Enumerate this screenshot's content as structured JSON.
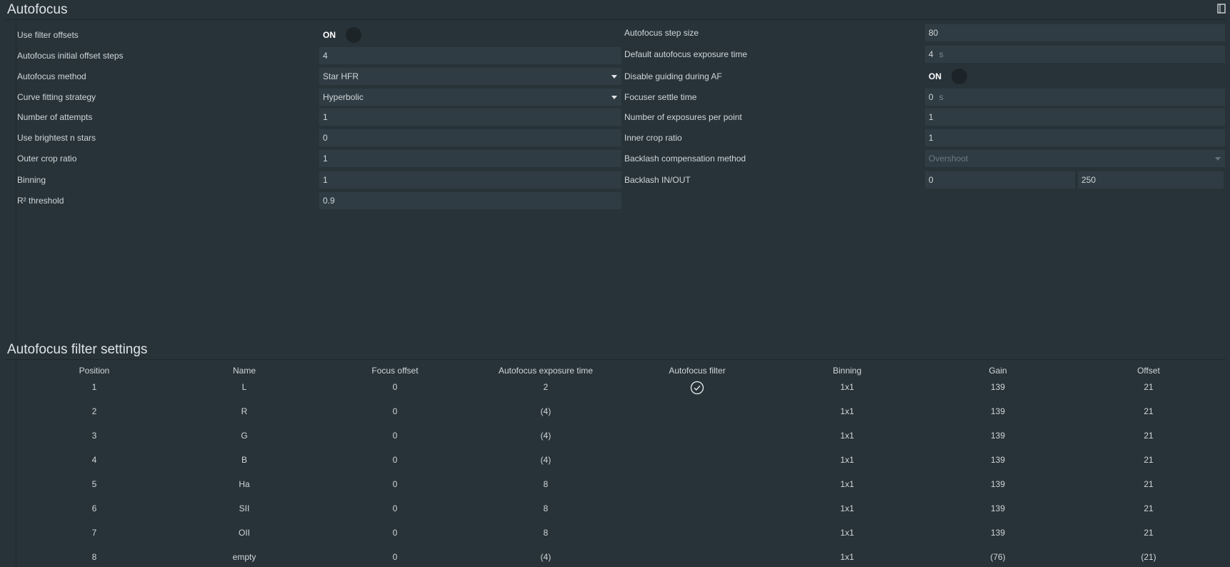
{
  "autofocus": {
    "title": "Autofocus",
    "left": [
      {
        "label": "Use filter offsets",
        "type": "toggle",
        "value": "ON"
      },
      {
        "label": "Autofocus initial offset steps",
        "type": "input",
        "value": "4"
      },
      {
        "label": "Autofocus method",
        "type": "select",
        "value": "Star HFR"
      },
      {
        "label": "Curve fitting strategy",
        "type": "select",
        "value": "Hyperbolic"
      },
      {
        "label": "Number of attempts",
        "type": "input",
        "value": "1"
      },
      {
        "label": "Use brightest n stars",
        "type": "input",
        "value": "0"
      },
      {
        "label": "Outer crop ratio",
        "type": "input",
        "value": "1"
      },
      {
        "label": "Binning",
        "type": "input",
        "value": "1"
      },
      {
        "label": "R² threshold",
        "type": "input",
        "value": "0.9"
      }
    ],
    "right": [
      {
        "label": "Autofocus step size",
        "type": "input",
        "value": "80"
      },
      {
        "label": "Default autofocus exposure time",
        "type": "input",
        "value": "4",
        "unit": "s"
      },
      {
        "label": "Disable guiding during AF",
        "type": "toggle",
        "value": "ON"
      },
      {
        "label": "Focuser settle time",
        "type": "input",
        "value": "0",
        "unit": "s"
      },
      {
        "label": "Number of exposures per point",
        "type": "input",
        "value": "1"
      },
      {
        "label": "Inner crop ratio",
        "type": "input",
        "value": "1"
      },
      {
        "label": "Backlash compensation method",
        "type": "select",
        "value": "Overshoot",
        "disabled": true
      },
      {
        "label": "Backlash IN/OUT",
        "type": "pair",
        "value": "0",
        "value2": "250"
      }
    ]
  },
  "filter_settings": {
    "title": "Autofocus filter settings",
    "columns": [
      "Position",
      "Name",
      "Focus offset",
      "Autofocus exposure time",
      "Autofocus filter",
      "Binning",
      "Gain",
      "Offset"
    ],
    "rows": [
      {
        "position": "1",
        "name": "L",
        "focus_offset": "0",
        "exposure": "2",
        "af_filter": true,
        "binning": "1x1",
        "gain": "139",
        "offset": "21"
      },
      {
        "position": "2",
        "name": "R",
        "focus_offset": "0",
        "exposure": "(4)",
        "af_filter": false,
        "binning": "1x1",
        "gain": "139",
        "offset": "21"
      },
      {
        "position": "3",
        "name": "G",
        "focus_offset": "0",
        "exposure": "(4)",
        "af_filter": false,
        "binning": "1x1",
        "gain": "139",
        "offset": "21"
      },
      {
        "position": "4",
        "name": "B",
        "focus_offset": "0",
        "exposure": "(4)",
        "af_filter": false,
        "binning": "1x1",
        "gain": "139",
        "offset": "21"
      },
      {
        "position": "5",
        "name": "Ha",
        "focus_offset": "0",
        "exposure": "8",
        "af_filter": false,
        "binning": "1x1",
        "gain": "139",
        "offset": "21"
      },
      {
        "position": "6",
        "name": "SII",
        "focus_offset": "0",
        "exposure": "8",
        "af_filter": false,
        "binning": "1x1",
        "gain": "139",
        "offset": "21"
      },
      {
        "position": "7",
        "name": "OII",
        "focus_offset": "0",
        "exposure": "8",
        "af_filter": false,
        "binning": "1x1",
        "gain": "139",
        "offset": "21"
      },
      {
        "position": "8",
        "name": "empty",
        "focus_offset": "0",
        "exposure": "(4)",
        "af_filter": false,
        "binning": "1x1",
        "gain": "(76)",
        "offset": "(21)"
      }
    ]
  },
  "icons": {
    "top_right": "book-icon",
    "af_filter_check": "check-circle-icon"
  },
  "colors": {
    "background": "#283339",
    "field": "#303c43",
    "text": "#cfd6da"
  }
}
